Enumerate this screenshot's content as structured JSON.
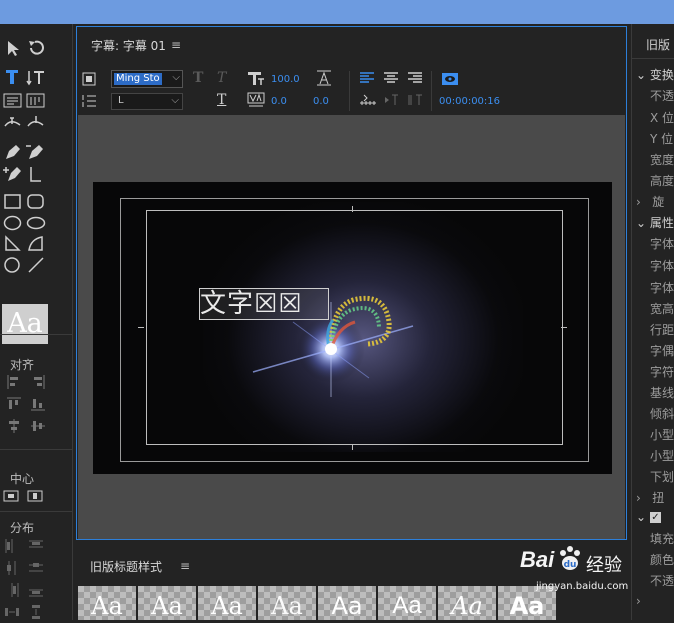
{
  "title_panel": {
    "title": "字幕: 字幕 01",
    "menu": "≡",
    "font_family": "Ming Sto",
    "font_style": "L",
    "font_size": "100.0",
    "tracking": "0.0",
    "kerning": "0.0",
    "timecode": "00:00:00:16"
  },
  "canvas": {
    "title_text": "文字☒☒"
  },
  "tools_panel": {
    "preview_label": "Aa",
    "align_label": "对齐",
    "center_label": "中心",
    "distribute_label": "分布"
  },
  "properties_panel": {
    "header": "旧版",
    "sections": [
      {
        "label": "变换",
        "items": [
          "不透",
          "X 位",
          "Y 位",
          "宽度",
          "高度",
          "旋"
        ]
      },
      {
        "label": "属性",
        "items": [
          "字体",
          "字体",
          "字体",
          "宽高",
          "行距",
          "字偶",
          "字符",
          "基线",
          "倾斜",
          "小型",
          "小型",
          "下划",
          "扭"
        ]
      },
      {
        "label": "",
        "items": [
          "填充",
          "颜色",
          "不透"
        ]
      }
    ]
  },
  "styles_panel": {
    "title": "旧版标题样式",
    "menu": "≡",
    "thumbnails": [
      "Aa",
      "Aa",
      "Aa",
      "Aa",
      "Aa",
      "Aa",
      "Aa",
      "Aa"
    ]
  },
  "watermark": {
    "brand": "Bai",
    "product": "经验",
    "url": "jingyan.baidu.com"
  },
  "colors": {
    "accent_blue": "#2d7fd9",
    "top_bar": "#6d9be0",
    "panel_bg": "#232323",
    "number_blue": "#3b8ef0"
  }
}
